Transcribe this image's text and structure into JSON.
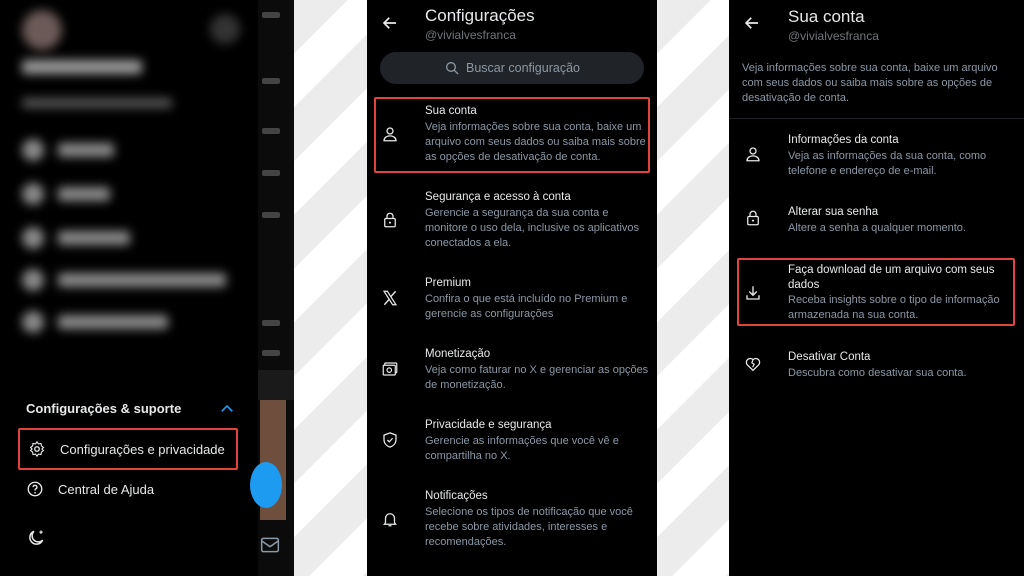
{
  "panel1": {
    "section_title": "Configurações & suporte",
    "items": [
      {
        "label": "Configurações e privacidade"
      },
      {
        "label": "Central de Ajuda"
      }
    ]
  },
  "panel2": {
    "title": "Configurações",
    "handle": "@vivialvesfranca",
    "search_placeholder": "Buscar configuração",
    "items": [
      {
        "title": "Sua conta",
        "desc": "Veja informações sobre sua conta, baixe um arquivo com seus dados ou saiba mais sobre as opções de desativação de conta.",
        "icon": "person-icon"
      },
      {
        "title": "Segurança e acesso à conta",
        "desc": "Gerencie a segurança da sua conta e monitore o uso dela, inclusive os aplicativos conectados a ela.",
        "icon": "lock-icon"
      },
      {
        "title": "Premium",
        "desc": "Confira o que está incluído no Premium e gerencie as configurações",
        "icon": "x-logo-icon"
      },
      {
        "title": "Monetização",
        "desc": "Veja como faturar no X e gerenciar as opções de monetização.",
        "icon": "money-icon"
      },
      {
        "title": "Privacidade e segurança",
        "desc": "Gerencie as informações que você vê e compartilha no X.",
        "icon": "shield-icon"
      },
      {
        "title": "Notificações",
        "desc": "Selecione os tipos de notificação que você recebe sobre atividades, interesses e recomendações.",
        "icon": "bell-icon"
      }
    ]
  },
  "panel3": {
    "title": "Sua conta",
    "handle": "@vivialvesfranca",
    "intro": "Veja informações sobre sua conta, baixe um arquivo com seus dados ou saiba mais sobre as opções de desativação de conta.",
    "items": [
      {
        "title": "Informações da conta",
        "desc": "Veja as informações da sua conta, como telefone e endereço de e-mail.",
        "icon": "person-icon"
      },
      {
        "title": "Alterar sua senha",
        "desc": "Altere a senha a qualquer momento.",
        "icon": "lock-icon"
      },
      {
        "title": "Faça download de um arquivo com seus dados",
        "desc": "Receba insights sobre o tipo de informação armazenada na sua conta.",
        "icon": "download-icon"
      },
      {
        "title": "Desativar Conta",
        "desc": "Descubra como desativar sua conta.",
        "icon": "broken-heart-icon"
      }
    ]
  },
  "colors": {
    "highlight": "#e0443a",
    "background": "#000000",
    "primary_text": "#e7e9ea",
    "secondary_text": "#8b98a5",
    "accent": "#1d9bf0"
  }
}
